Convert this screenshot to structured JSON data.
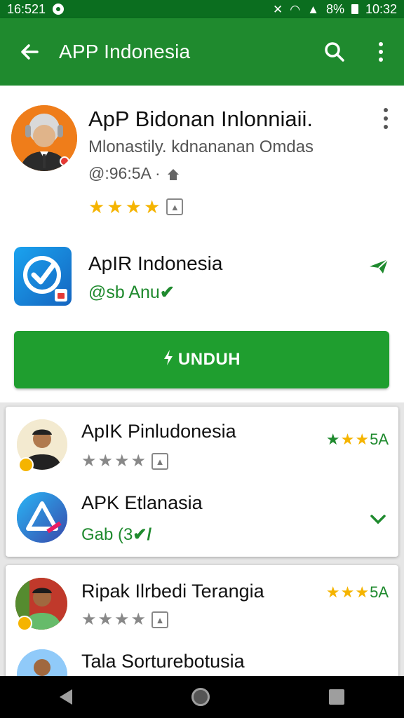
{
  "status_bar": {
    "time_left": "16:521",
    "battery": "8%",
    "time_right": "10:32"
  },
  "app_bar": {
    "title": "APP Indonesia",
    "back_icon": "back-arrow-icon",
    "search_icon": "search-icon",
    "menu_icon": "more-vert-icon"
  },
  "developer": {
    "name": "ApP Bidonan Inlonniaii.",
    "subtitle": "Mlonastily. kdnananan Omdas",
    "meta": "@:96:5A ·",
    "rating": 4,
    "accent": "#ef7d1a"
  },
  "app": {
    "name": "ApIR Indonesia",
    "sub": "@sb Anu",
    "icon_color": "#1aa3ef"
  },
  "download": {
    "label": "UNDUH"
  },
  "list": [
    {
      "name": "ApIK Pinludonesia",
      "rating_value": "5A",
      "rating": 4,
      "stars_right": 3
    },
    {
      "name": "APK Etlanasia",
      "sub": "Gab (3"
    },
    {
      "name": "Ripak Ilrbedi Terangia",
      "rating_value": "5A",
      "rating": 4,
      "stars_right": 3
    },
    {
      "name": "Tala Sorturebotusia"
    }
  ],
  "colors": {
    "primary": "#1f8a2e",
    "status": "#0b6e1f",
    "button": "#1f9e2f",
    "star": "#f5b400"
  }
}
